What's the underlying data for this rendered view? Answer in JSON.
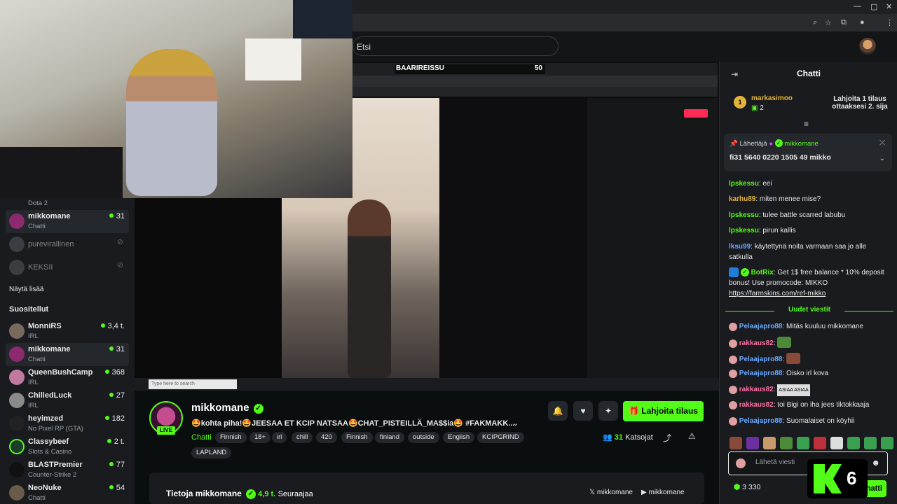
{
  "header": {
    "search_placeholder": "Etsi"
  },
  "stream_overlay": {
    "title": "BAARIREISSU",
    "number": "50",
    "taskbar_search_placeholder": "Type here to search"
  },
  "sidebar": {
    "top_category": "Dota 2",
    "following": [
      {
        "name": "mikkomane",
        "sub": "Chatti",
        "count": "31",
        "online": true,
        "active": true
      },
      {
        "name": "purevirallinen",
        "sub": "",
        "count": "",
        "online": false,
        "active": false
      },
      {
        "name": "KEKSII",
        "sub": "",
        "count": "",
        "online": false,
        "active": false
      }
    ],
    "show_more": "Näytä lisää",
    "recommended_title": "Suositellut",
    "recommended": [
      {
        "name": "MonniRS",
        "sub": "IRL",
        "count": "3,4 t."
      },
      {
        "name": "mikkomane",
        "sub": "Chatti",
        "count": "31"
      },
      {
        "name": "QueenBushCamp",
        "sub": "IRL",
        "count": "368"
      },
      {
        "name": "ChilledLuck",
        "sub": "IRL",
        "count": "27"
      },
      {
        "name": "heyimzed",
        "sub": "No Pixel RP (GTA)",
        "count": "182"
      },
      {
        "name": "Classybeef",
        "sub": "Slots & Casino",
        "count": "2 t."
      },
      {
        "name": "BLASTPremier",
        "sub": "Counter-Strike 2",
        "count": "77"
      },
      {
        "name": "NeoNuke",
        "sub": "Chatti",
        "count": "54"
      }
    ]
  },
  "channel": {
    "name": "mikkomane",
    "live_badge": "LIVE",
    "title": "🤩kohta piha!🤩JEESAA ET KCIP NATSAA🤩CHAT_PISTEILLÄ_MA$$ia🤩 #FAKMAKK...",
    "category": "Chatti",
    "tags": [
      "Finnish",
      "18+",
      "irl",
      "chill",
      "420",
      "Finnish",
      "finland",
      "outside",
      "English",
      "KCIPGRIND",
      "LAPLAND"
    ],
    "subscribe_label": "Lahjoita tilaus",
    "viewers_count": "31",
    "viewers_label": "Katsojat",
    "about_title": "Tietoja mikkomane",
    "followers_count": "4,9 t.",
    "followers_label": "Seuraajaa",
    "social_x": "mikkomane",
    "social_youtube": "mikkomane"
  },
  "chat": {
    "title": "Chatti",
    "leaderboard": {
      "rank": "1",
      "user": "markasimoo",
      "score": "2",
      "prompt": "Lahjoita 1 tilaus ottaaksesi 2. sija"
    },
    "pinned": {
      "label": "Lähettäjä",
      "user": "mikkomane",
      "message": "fi31 5640 0220 1505 49 mikko"
    },
    "messages": [
      {
        "user": "lpskessu",
        "color": "#53fc18",
        "text": ": eei"
      },
      {
        "user": "karhu89",
        "color": "#e3b43a",
        "text": ": miten menee mise?"
      },
      {
        "user": "lpskessu",
        "color": "#53fc18",
        "text": ": tulee battle scarred labubu"
      },
      {
        "user": "lpskessu",
        "color": "#53fc18",
        "text": ": pirun kallis"
      },
      {
        "user": "lksu99",
        "color": "#6aa8ff",
        "text": ": käytettynä noita varmaan saa jo alle satkulla"
      }
    ],
    "bot_message": {
      "user": "BotRix",
      "text": ": Get 1$ free balance * 10% deposit bonus! Use promocode: MIKKO",
      "link": "https://farmskins.com/ref-mikko"
    },
    "new_messages_label": "Uudet viestit",
    "new_messages": [
      {
        "user": "Pelaajapro88",
        "color": "#6aa8ff",
        "text": ": Mitäs kuuluu mikkomane"
      },
      {
        "user": "rakkaus82",
        "color": "#ff6fa3",
        "text": ":"
      },
      {
        "user": "Pelaajapro88",
        "color": "#6aa8ff",
        "text": ":"
      },
      {
        "user": "Pelaajapro88",
        "color": "#6aa8ff",
        "text": ": Oisko irl kova"
      },
      {
        "user": "rakkaus82",
        "color": "#ff6fa3",
        "text": ":"
      },
      {
        "user": "rakkaus82",
        "color": "#ff6fa3",
        "text": ": toi Bigi on iha jees tiktokkaaja"
      },
      {
        "user": "Pelaajapro88",
        "color": "#6aa8ff",
        "text": ": Suomalaiset on köyhii"
      }
    ],
    "emote_text": "ASIAA ASIAA",
    "input_placeholder": "Lähetä viesti",
    "points": "3 330",
    "send_label": "Chatti"
  },
  "overlay_badge": {
    "number": "6"
  },
  "colors": {
    "accent": "#53fc18",
    "background": "#0b0e0f",
    "panel": "#191b1f"
  }
}
